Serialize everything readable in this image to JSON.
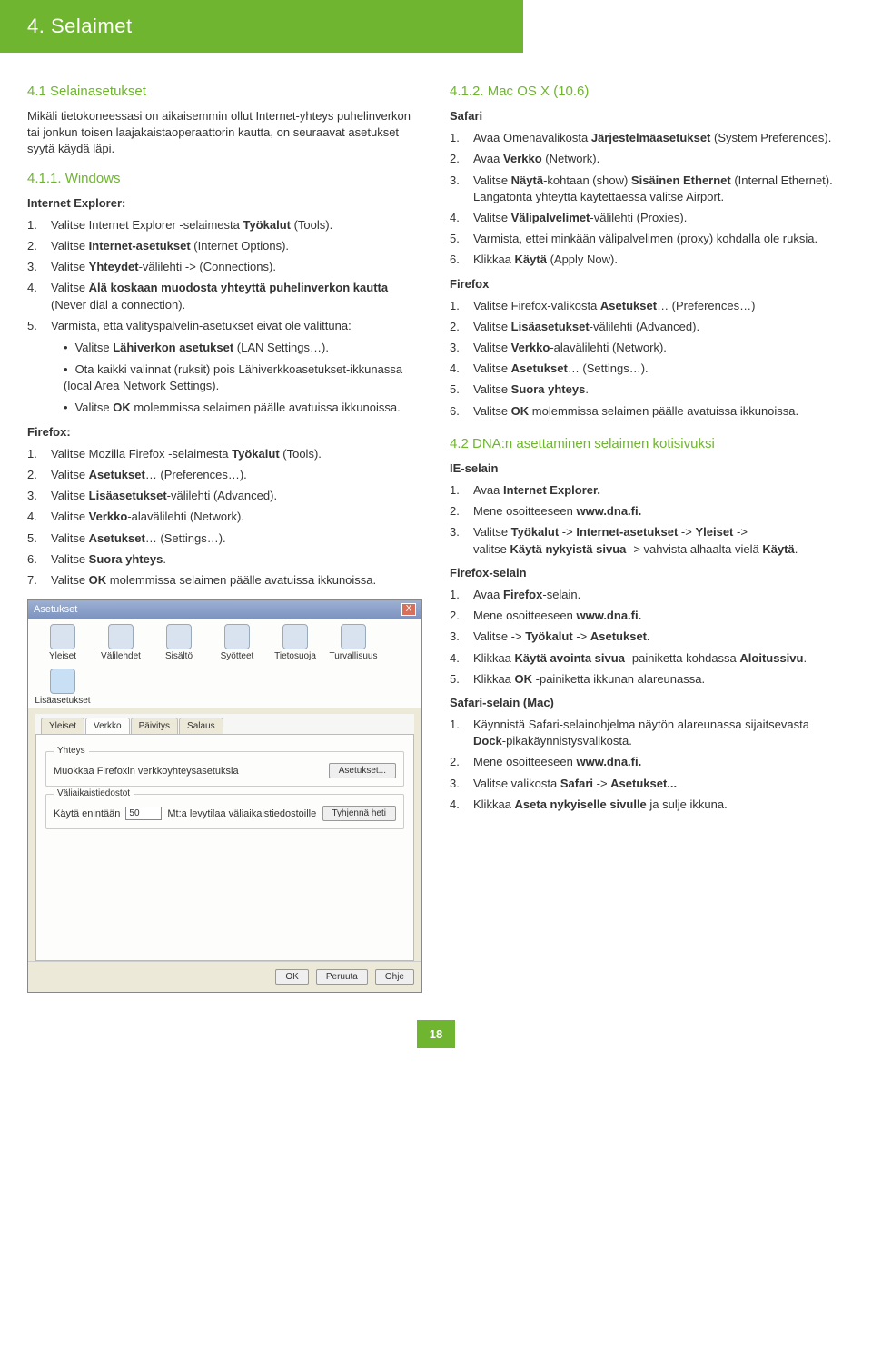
{
  "banner": "4. Selaimet",
  "left": {
    "h1": "4.1 Selainasetukset",
    "intro": "Mikäli tietokoneessasi on aikaisemmin ollut Internet-yhteys puhelinverkon tai jonkun toisen laajakaistaoperaattorin kautta, on seuraavat asetukset syytä käydä läpi.",
    "h2": "4.1.1. Windows",
    "ie_head": "Internet Explorer:",
    "ie": [
      "Valitse Internet Explorer -selaimesta <b>Työkalut</b> (Tools).",
      "Valitse <b>Internet-asetukset</b> (Internet Options).",
      "Valitse <b>Yhteydet</b>-välilehti -> (Connections).",
      "Valitse <b>Älä koskaan muodosta yhteyttä puhelinverkon kautta</b> (Never dial a connection).",
      "Varmista, että välityspalvelin-asetukset eivät ole valittuna:"
    ],
    "ie_bul": [
      "Valitse <b>Lähiverkon asetukset</b> (LAN Settings…).",
      "Ota kaikki valinnat (ruksit) pois Lähiverkkoasetukset-ikkunassa (local Area Network Settings).",
      "Valitse <b>OK</b> molemmissa selaimen päälle avatuissa ikkunoissa."
    ],
    "ff_head": "Firefox:",
    "ff": [
      "Valitse Mozilla Firefox -selaimesta <b>Työkalut</b> (Tools).",
      "Valitse <b>Asetukset</b>… (Preferences…).",
      "Valitse <b>Lisäasetukset</b>-välilehti (Advanced).",
      "Valitse <b>Verkko</b>-alavälilehti (Network).",
      "Valitse <b>Asetukset</b>… (Settings…).",
      "Valitse <b>Suora yhteys</b>.",
      "Valitse <b>OK</b> molemmissa selaimen päälle avatuissa ikkunoissa."
    ]
  },
  "right": {
    "h1": "4.1.2. Mac OS X (10.6)",
    "saf_head": "Safari",
    "saf": [
      "Avaa Omenavalikosta <b>Järjestelmäasetukset</b> (System Preferences).",
      "Avaa <b>Verkko</b> (Network).",
      "Valitse <b>Näytä</b>-kohtaan (show) <b>Sisäinen Ethernet</b> (Internal Ethernet). Langatonta yhteyttä käytettäessä valitse Airport.",
      "Valitse <b>Välipalvelimet</b>-välilehti (Proxies).",
      "Varmista, ettei minkään välipalvelimen (proxy) kohdalla ole ruksia.",
      "Klikkaa <b>Käytä</b> (Apply Now)."
    ],
    "ff2_head": "Firefox",
    "ff2": [
      "Valitse Firefox-valikosta <b>Asetukset</b>… (Preferences…)",
      "Valitse <b>Lisäasetukset</b>-välilehti (Advanced).",
      "Valitse <b>Verkko</b>-alavälilehti (Network).",
      "Valitse <b>Asetukset</b>… (Settings…).",
      "Valitse <b>Suora yhteys</b>.",
      "Valitse <b>OK</b> molemmissa selaimen päälle avatuissa ikkunoissa."
    ],
    "h2": "4.2 DNA:n asettaminen selaimen kotisivuksi",
    "ies_head": "IE-selain",
    "ies": [
      "Avaa <b>Internet Explorer.</b>",
      "Mene osoitteeseen <b>www.dna.fi.</b>",
      "Valitse <b>Työkalut</b> -> <b>Internet-asetukset</b> -> <b>Yleiset</b> -><br>valitse <b>Käytä nykyistä sivua</b> -> vahvista alhaalta vielä <b>Käytä</b>."
    ],
    "ffs_head": "Firefox-selain",
    "ffs": [
      "Avaa <b>Firefox</b>-selain.",
      "Mene osoitteeseen <b>www.dna.fi.</b>",
      "Valitse -> <b>Työkalut</b> -> <b>Asetukset.</b>",
      "Klikkaa <b>Käytä avointa sivua</b> -painiketta kohdassa <b>Aloitussivu</b>.",
      "Klikkaa <b>OK</b> -painiketta ikkunan alareunassa."
    ],
    "sfs_head": "Safari-selain (Mac)",
    "sfs": [
      "Käynnistä Safari-selainohjelma näytön alareunassa sijaitsevasta <b>Dock</b>-pikakäynnistysvalikosta.",
      "Mene osoitteeseen <b>www.dna.fi.</b>",
      "Valitse valikosta <b>Safari</b> -> <b>Asetukset...</b>",
      "Klikkaa <b>Aseta nykyiselle sivulle</b> ja sulje ikkuna."
    ]
  },
  "ss": {
    "title": "Asetukset",
    "icons": [
      "Yleiset",
      "Välilehdet",
      "Sisältö",
      "Syötteet",
      "Tietosuoja",
      "Turvallisuus",
      "Lisäasetukset"
    ],
    "tabs": [
      "Yleiset",
      "Verkko",
      "Päivitys",
      "Salaus"
    ],
    "f1_legend": "Yhteys",
    "f1_text": "Muokkaa Firefoxin verkkoyhteysasetuksia",
    "f1_btn": "Asetukset...",
    "f2_legend": "Väliaikaistiedostot",
    "f2_pre": "Käytä enintään",
    "f2_val": "50",
    "f2_post": "Mt:a levytilaa väliaikaistiedostoille",
    "f2_btn": "Tyhjennä heti",
    "ok": "OK",
    "cancel": "Peruuta",
    "help": "Ohje"
  },
  "page": "18"
}
